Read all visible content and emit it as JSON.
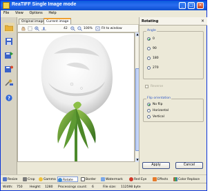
{
  "window": {
    "title": "ReaTIFF Single Image mode"
  },
  "title_buttons": {
    "minimize": "_",
    "maximize": "□",
    "close": "×"
  },
  "menu": [
    "File",
    "View",
    "Options",
    "Help"
  ],
  "tabs": [
    "Original image",
    "Current image"
  ],
  "toolbar": {
    "zoom_value": "42",
    "zoom_percent": "100%",
    "fit_label": "Fit to window"
  },
  "panel": {
    "title": "Rotating",
    "close": "×",
    "angle_legend": "Angle",
    "angles": [
      "0",
      "90",
      "180",
      "270"
    ],
    "angle_selected": "0",
    "reverse_label": "Reverse",
    "flip_legend": "Flip orientation",
    "flip_options": [
      "No flip",
      "Horizontal",
      "Vertical"
    ],
    "flip_selected": "No flip",
    "apply_label": "Apply",
    "cancel_label": "Cancel"
  },
  "bottom_tools": [
    "Resize",
    "Crop",
    "Gamma",
    "Rotate",
    "Border",
    "Watermark",
    "Red Eye",
    "Effects",
    "Color Replace"
  ],
  "status": {
    "width_label": "Width:",
    "width_value": "750",
    "height_label": "Height:",
    "height_value": "1280",
    "proc_label": "Processings count:",
    "proc_value": "6",
    "size_label": "File size:",
    "size_value": "112598 byte"
  },
  "colors": {
    "title_blue": "#0a5bdc",
    "panel_bg": "#ece9d8",
    "accent_orange": "#f0a030",
    "radio_green": "#21a121"
  }
}
